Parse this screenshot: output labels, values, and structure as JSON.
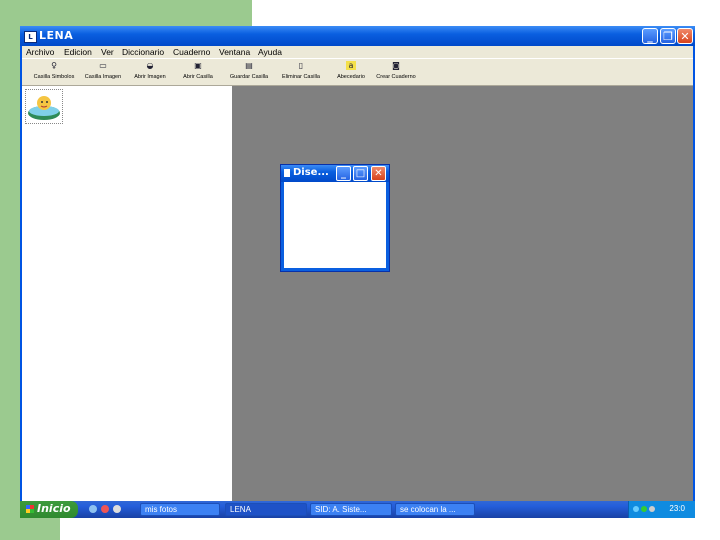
{
  "window": {
    "title": "LENA"
  },
  "menu": [
    "Archivo",
    "Edicion",
    "Ver",
    "Diccionario",
    "Cuaderno",
    "Ventana",
    "Ayuda"
  ],
  "toolbar": [
    {
      "label": "Casilla Simbolos",
      "icon": "symbol-cell-icon"
    },
    {
      "label": "Casilla Imagen",
      "icon": "image-cell-icon"
    },
    {
      "label": "Abrir Imagen",
      "icon": "open-image-icon"
    },
    {
      "label": "Abrir Casilla",
      "icon": "open-cell-icon"
    },
    {
      "label": "Guardar Casilla",
      "icon": "save-cell-icon"
    },
    {
      "label": "Eliminar Casilla",
      "icon": "delete-cell-icon"
    },
    {
      "label": "Abecedario",
      "icon": "alphabet-icon"
    },
    {
      "label": "Crear Cuaderno",
      "icon": "create-notebook-icon"
    }
  ],
  "child_window": {
    "title": "Dise..."
  },
  "taskbar": {
    "start": "Inicio",
    "tasks": [
      {
        "label": "mis fotos",
        "active": false
      },
      {
        "label": "LENA",
        "active": true
      },
      {
        "label": "SID: A. Siste...",
        "active": false
      },
      {
        "label": "se colocan la ...",
        "active": false
      }
    ],
    "clock": "23:0"
  },
  "colors": {
    "accent": "#0a5fe0",
    "mdi_background": "#808080",
    "slide_green": "#9bca8f"
  }
}
